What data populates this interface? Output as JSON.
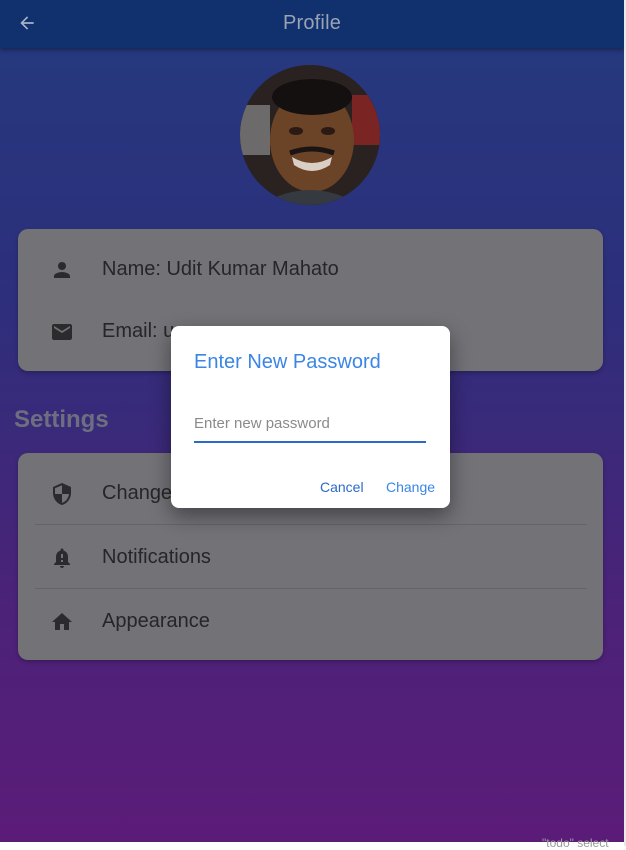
{
  "appbar": {
    "title": "Profile",
    "back_icon": "arrow-back-icon"
  },
  "profile": {
    "avatar_icon": "profile-photo",
    "name_icon": "person-icon",
    "name": "Name: Udit Kumar Mahato",
    "email_icon": "email-icon",
    "email": "Email: u"
  },
  "settings": {
    "heading": "Settings",
    "items": [
      {
        "icon": "shield-icon",
        "label": "Change"
      },
      {
        "icon": "notification-bell-icon",
        "label": "Notifications"
      },
      {
        "icon": "home-icon",
        "label": "Appearance"
      }
    ]
  },
  "dialog": {
    "title": "Enter New Password",
    "input_placeholder": "Enter new password",
    "input_value": "",
    "cancel_label": "Cancel",
    "change_label": "Change"
  },
  "debug_banner": "\"todo\" select"
}
